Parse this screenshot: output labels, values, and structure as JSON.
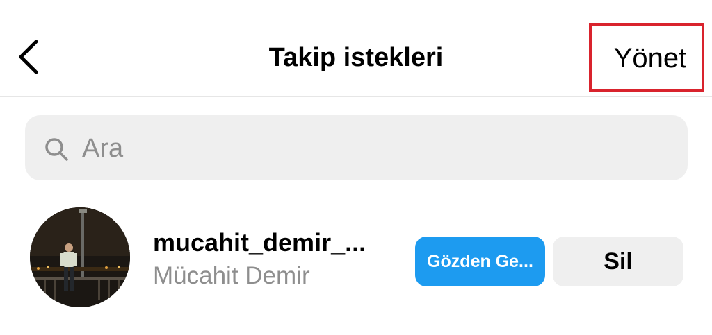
{
  "header": {
    "back_icon": "chevron-left-icon",
    "title": "Takip istekleri",
    "manage_label": "Yönet",
    "highlight_color": "#d9232d"
  },
  "search": {
    "icon": "search-icon",
    "placeholder": "Ara",
    "value": ""
  },
  "requests": [
    {
      "avatar": "profile-photo",
      "username": "mucahit_demir_...",
      "full_name": "Mücahit Demir",
      "review_label": "Gözden Ge...",
      "delete_label": "Sil"
    }
  ],
  "colors": {
    "accent": "#1d9bf0",
    "secondary_button": "#efefef",
    "muted_text": "#8e8e8e"
  }
}
